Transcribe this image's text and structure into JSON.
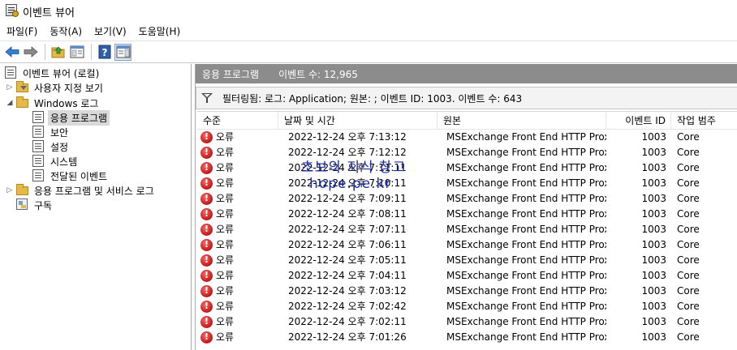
{
  "window": {
    "title": "이벤트 뷰어"
  },
  "menu": [
    {
      "label": "파일(F)"
    },
    {
      "label": "동작(A)"
    },
    {
      "label": "보기(V)"
    },
    {
      "label": "도움말(H)"
    }
  ],
  "toolbar": {
    "buttons": [
      "back-icon",
      "forward-icon",
      "folder-up-icon",
      "properties-icon",
      "help-icon",
      "show-hide-pane-icon"
    ]
  },
  "tree": {
    "root": "이벤트 뷰어 (로컬)",
    "custom_views": "사용자 지정 보기",
    "windows_logs": "Windows 로그",
    "application": "응용 프로그램",
    "security": "보안",
    "setup": "설정",
    "system": "시스템",
    "forwarded": "전달된 이벤트",
    "apps_services": "응용 프로그램 및 서비스 로그",
    "subscriptions": "구독"
  },
  "header": {
    "log_name": "응용 프로그램",
    "event_count": "이벤트 수: 12,965"
  },
  "filter": {
    "text": "필터링됨: 로그: Application; 원본: ; 이벤트 ID: 1003. 이벤트 수: 643"
  },
  "columns": {
    "level": "수준",
    "datetime": "날짜 및 시간",
    "source": "원본",
    "event_id": "이벤트 ID",
    "category": "작업 범주"
  },
  "rows": [
    {
      "level": "오류",
      "datetime": "2022-12-24 오후 7:13:12",
      "source": "MSExchange Front End HTTP Proxy",
      "event_id": "1003",
      "category": "Core"
    },
    {
      "level": "오류",
      "datetime": "2022-12-24 오후 7:12:12",
      "source": "MSExchange Front End HTTP Proxy",
      "event_id": "1003",
      "category": "Core"
    },
    {
      "level": "오류",
      "datetime": "2022-12-24 오후 7:11:11",
      "source": "MSExchange Front End HTTP Proxy",
      "event_id": "1003",
      "category": "Core"
    },
    {
      "level": "오류",
      "datetime": "2022-12-24 오후 7:10:11",
      "source": "MSExchange Front End HTTP Proxy",
      "event_id": "1003",
      "category": "Core"
    },
    {
      "level": "오류",
      "datetime": "2022-12-24 오후 7:09:11",
      "source": "MSExchange Front End HTTP Proxy",
      "event_id": "1003",
      "category": "Core"
    },
    {
      "level": "오류",
      "datetime": "2022-12-24 오후 7:08:11",
      "source": "MSExchange Front End HTTP Proxy",
      "event_id": "1003",
      "category": "Core"
    },
    {
      "level": "오류",
      "datetime": "2022-12-24 오후 7:07:11",
      "source": "MSExchange Front End HTTP Proxy",
      "event_id": "1003",
      "category": "Core"
    },
    {
      "level": "오류",
      "datetime": "2022-12-24 오후 7:06:11",
      "source": "MSExchange Front End HTTP Proxy",
      "event_id": "1003",
      "category": "Core"
    },
    {
      "level": "오류",
      "datetime": "2022-12-24 오후 7:05:11",
      "source": "MSExchange Front End HTTP Proxy",
      "event_id": "1003",
      "category": "Core"
    },
    {
      "level": "오류",
      "datetime": "2022-12-24 오후 7:04:11",
      "source": "MSExchange Front End HTTP Proxy",
      "event_id": "1003",
      "category": "Core"
    },
    {
      "level": "오류",
      "datetime": "2022-12-24 오후 7:03:12",
      "source": "MSExchange Front End HTTP Proxy",
      "event_id": "1003",
      "category": "Core"
    },
    {
      "level": "오류",
      "datetime": "2022-12-24 오후 7:02:42",
      "source": "MSExchange Front End HTTP Proxy",
      "event_id": "1003",
      "category": "Core"
    },
    {
      "level": "오류",
      "datetime": "2022-12-24 오후 7:02:11",
      "source": "MSExchange Front End HTTP Proxy",
      "event_id": "1003",
      "category": "Core"
    },
    {
      "level": "오류",
      "datetime": "2022-12-24 오후 7:01:26",
      "source": "MSExchange Front End HTTP Proxy",
      "event_id": "1003",
      "category": "Core"
    }
  ],
  "watermark": {
    "line1": "초보의 지식 창고",
    "line2": "hope.pe.kr"
  },
  "colors": {
    "pane_header": "#8c8c8c",
    "error_red": "#c31616",
    "watermark_blue": "#1e2ea8",
    "selection": "#d9d9d9"
  }
}
